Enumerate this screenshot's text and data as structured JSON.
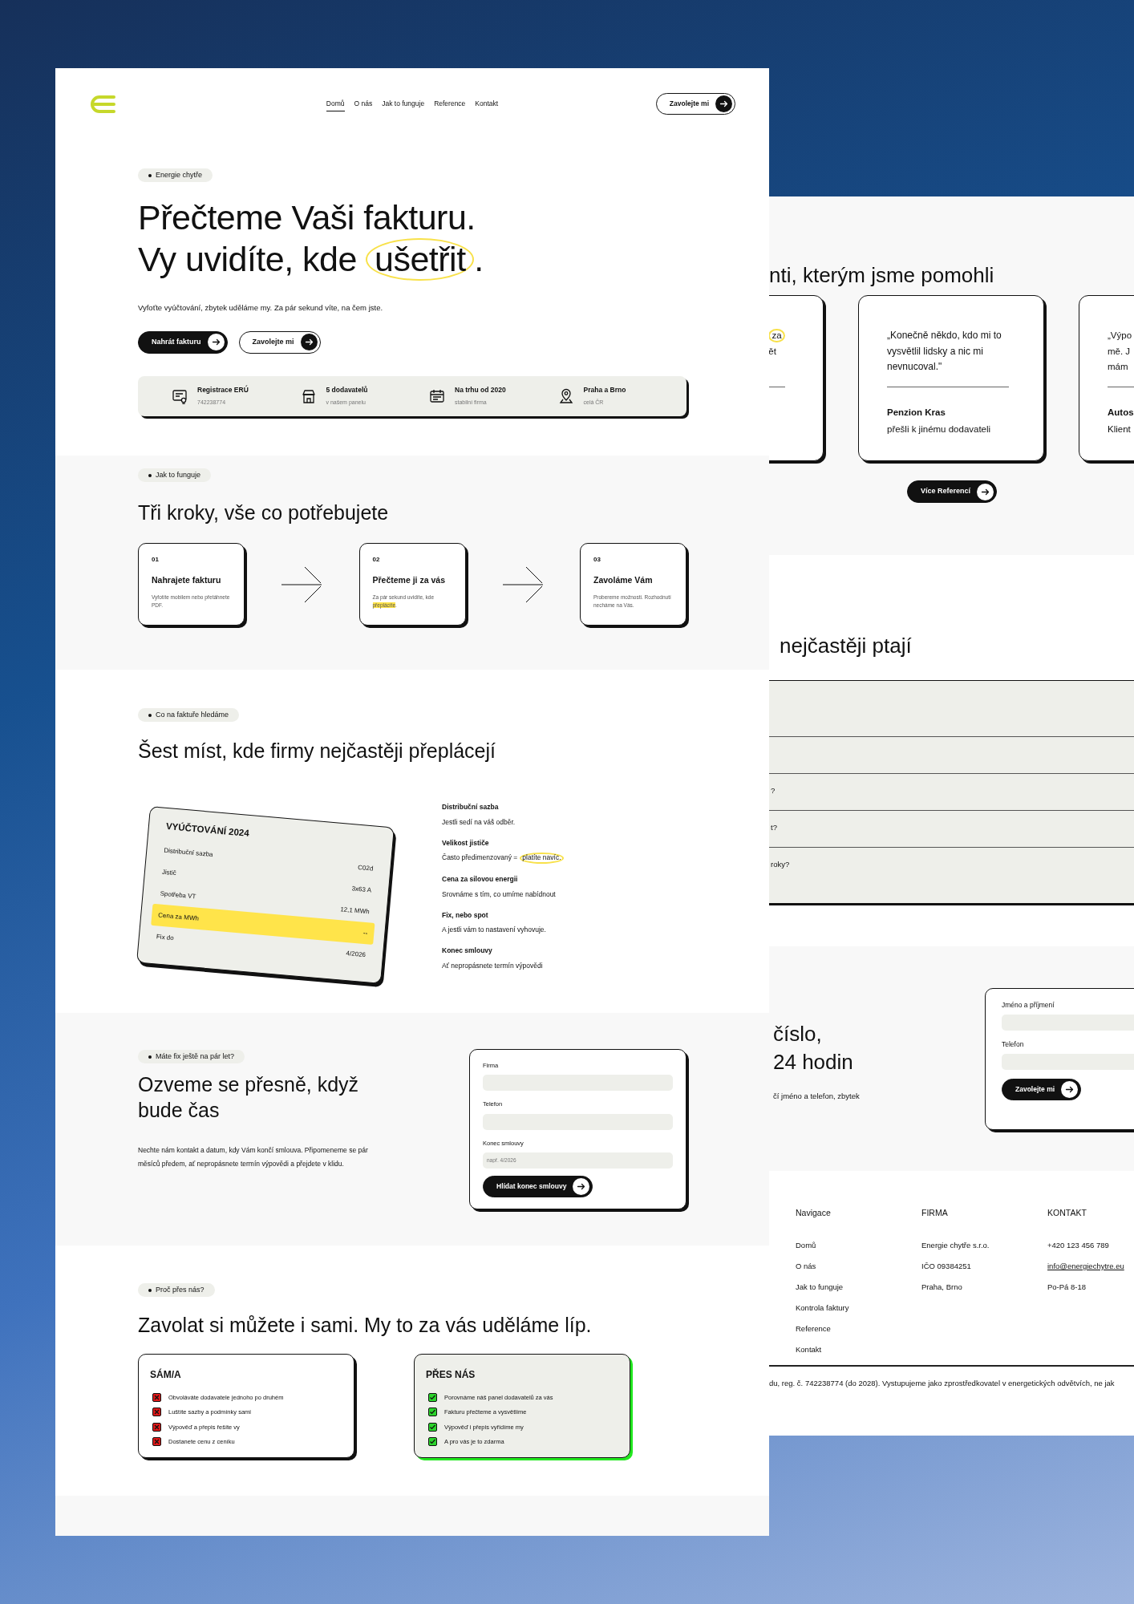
{
  "nav": {
    "links": [
      {
        "label": "Domů",
        "selected": true
      },
      {
        "label": "O nás",
        "selected": false
      },
      {
        "label": "Jak to funguje",
        "selected": false
      },
      {
        "label": "Reference",
        "selected": false
      },
      {
        "label": "Kontakt",
        "selected": false
      }
    ],
    "cta": "Zavolejte mi"
  },
  "hero": {
    "badge": "Energie chytře",
    "title_line1": "Přečteme Vaši fakturu.",
    "title_line2": "Vy uvidíte, kde",
    "title_circled": "ušetřit",
    "title_end": ".",
    "subtitle": "Vyfoťte vyúčtování, zbytek uděláme my. Za pár sekund víte, na čem jste.",
    "buttons": [
      {
        "label": "Nahrát fakturu",
        "kind": "primary"
      },
      {
        "label": "Zavolejte mi",
        "kind": "secondary"
      }
    ],
    "stats": [
      {
        "title": "Registrace ERÚ",
        "subtitle": "742238774"
      },
      {
        "title": "5 dodavatelů",
        "subtitle": "v našem panelu"
      },
      {
        "title": "Na trhu od 2020",
        "subtitle": "stabilní firma"
      },
      {
        "title": "Praha a Brno",
        "subtitle": "celá ČR"
      }
    ]
  },
  "steps": {
    "badge": "Jak to funguje",
    "title": "Tři kroky, vše co potřebujete",
    "items": [
      {
        "number": "01",
        "title": "Nahrajete fakturu",
        "text": "Vyfotíte mobilem nebo přetáhnete PDF."
      },
      {
        "number": "02",
        "title": "Přečteme ji za vás",
        "text": "Za pár sekund uvidíte, kde",
        "highlight": "přeplácíte",
        "text_end": "."
      },
      {
        "number": "03",
        "title": "Zavoláme Vám",
        "text": "Probereme možnosti. Rozhodnutí necháme na Vás."
      }
    ]
  },
  "invoice": {
    "badge": "Co na faktuře hledáme",
    "title": "Šest míst, kde firmy nejčastěji přeplácejí",
    "card": {
      "title": "VYÚČTOVÁNÍ 2024",
      "rows": [
        {
          "label": "Distribuční sazba",
          "value": "C02d",
          "highlighted": false
        },
        {
          "label": "Jistič",
          "value": "3x63 A",
          "highlighted": false
        },
        {
          "label": "Spotřeba VT",
          "value": "12,1 MWh",
          "highlighted": false
        },
        {
          "label": "Cena za MWh",
          "value": "--",
          "highlighted": true
        },
        {
          "label": "Fix do",
          "value": "4/2026",
          "highlighted": false
        }
      ]
    },
    "points": [
      {
        "title": "Distribuční sazba",
        "text": "Jestli sedí na váš odběr."
      },
      {
        "title": "Velikost jističe",
        "text": "Často předimenzovaný =",
        "circled": "platíte navíc."
      },
      {
        "title": "Cena za silovou energii",
        "text": "Srovnáme s tím, co umíme nabídnout"
      },
      {
        "title": "Fix, nebo spot",
        "text": "A jestli vám to nastavení vyhovuje."
      },
      {
        "title": "Konec smlouvy",
        "text": "Ať nepropásnete termín výpovědi"
      }
    ]
  },
  "reminder": {
    "badge": "Máte fix ještě na pár let?",
    "title": "Ozveme se přesně, když bude čas",
    "text": "Nechte nám kontakt a datum, kdy Vám končí smlouva. Připomeneme se pár měsíců předem, ať nepropásnete termín výpovědi a přejdete v klidu.",
    "fields": [
      {
        "label": "Firma"
      },
      {
        "label": "Telefon"
      },
      {
        "label": "Konec smlouvy",
        "placeholder": "např. 4/2026"
      }
    ],
    "button": "Hlídat konec smlouvy"
  },
  "comparison": {
    "badge": "Proč přes nás?",
    "title": "Zavolat si můžete i sami. My to za vás uděláme líp.",
    "cards": [
      {
        "title": "SÁM/A",
        "kind": "cons",
        "items": [
          "Obvoláváte dodavatele jednoho po druhém",
          "Luštíte sazby a podmínky sami",
          "Výpověď a přepis řešíte vy",
          "Dostanete cenu z ceníku"
        ]
      },
      {
        "title": "PŘES NÁS",
        "kind": "pros",
        "items": [
          "Porovnáme náš panel dodavatelů za vás",
          "Fakturu přečteme a vysvětlíme",
          "Výpověď i přepis vyřídíme my",
          "A pro vás je to zdarma"
        ]
      }
    ]
  },
  "second_page": {
    "testimonials": {
      "title": "nti, kterým jsme pomohli",
      "cards": [
        {
          "kind": "cut",
          "lines": [
            {
              "text": "za",
              "circled": true
            },
            {
              "text": "ět",
              "circled": false
            }
          ]
        },
        {
          "kind": "full",
          "quote": "„Konečně někdo, kdo mi to vysvětlil lidsky a nic mi nevnucoval.\"",
          "name": "Penzion Kras",
          "note": "přešli k jinému dodavateli"
        },
        {
          "kind": "cut",
          "lines": [
            {
              "text": "„Výpo",
              "circled": false
            },
            {
              "text": "mě. J",
              "circled": false
            },
            {
              "text": "mám",
              "circled": false
            }
          ],
          "name": "Autos",
          "note": "Klient"
        }
      ],
      "button": "Více Referencí"
    },
    "faq": {
      "title": "nejčastěji ptají",
      "rows": [
        {
          "kind": "blank"
        },
        {
          "kind": "blank"
        },
        {
          "kind": "text",
          "text": "?"
        },
        {
          "kind": "text",
          "text": "t?"
        },
        {
          "kind": "text",
          "text": "roky?"
        }
      ]
    },
    "callback": {
      "title_lines": [
        "číslo,",
        "24 hodin"
      ],
      "text": "čí jméno a telefon, zbytek",
      "fields": [
        {
          "label": "Jméno a příjmení"
        },
        {
          "label": "Telefon"
        }
      ],
      "button": "Zavolejte mi"
    },
    "footer": {
      "columns": [
        {
          "title": "Navigace",
          "items": [
            {
              "text": "Domů",
              "kind": "link"
            },
            {
              "text": "O nás",
              "kind": "link"
            },
            {
              "text": "Jak to funguje",
              "kind": "link"
            },
            {
              "text": "Kontrola faktury",
              "kind": "link"
            },
            {
              "text": "Reference",
              "kind": "link"
            },
            {
              "text": "Kontakt",
              "kind": "link"
            }
          ]
        },
        {
          "title": "FIRMA",
          "items": [
            {
              "text": "Energie chytře s.r.o.",
              "kind": "text"
            },
            {
              "text": "IČO 09384251",
              "kind": "text"
            },
            {
              "text": "Praha, Brno",
              "kind": "text"
            }
          ]
        },
        {
          "title": "KONTAKT",
          "items": [
            {
              "text": "+420 123 456 789",
              "kind": "text"
            },
            {
              "text": "info@energiechytre.eu",
              "kind": "email"
            },
            {
              "text": "Po-Pá 8-18",
              "kind": "text"
            }
          ]
        }
      ],
      "legal": "du, reg. č. 742238774 (do 2028). Vystupujeme jako zprostředkovatel v energetických odvětvích, ne jak"
    }
  }
}
